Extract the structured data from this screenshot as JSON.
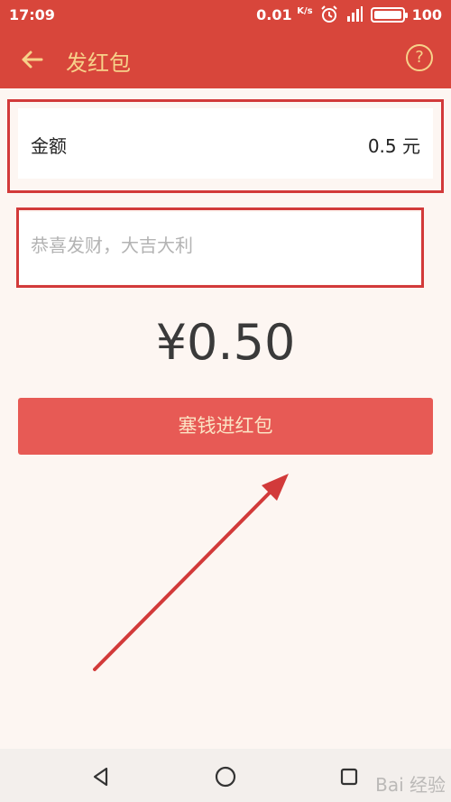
{
  "status_bar": {
    "time": "17:09",
    "speed_value": "0.01",
    "speed_unit": "K/s",
    "battery": "100"
  },
  "app_bar": {
    "title": "发红包"
  },
  "amount": {
    "label": "金额",
    "value": "0.5 元"
  },
  "message": {
    "placeholder": "恭喜发财，大吉大利"
  },
  "total": "¥0.50",
  "send_button": "塞钱进红包",
  "watermark": "Bai 经验",
  "colors": {
    "header": "#d8463b",
    "title_gold": "#f7d28a",
    "button": "#e75a55",
    "annotation": "#d23a3a"
  }
}
